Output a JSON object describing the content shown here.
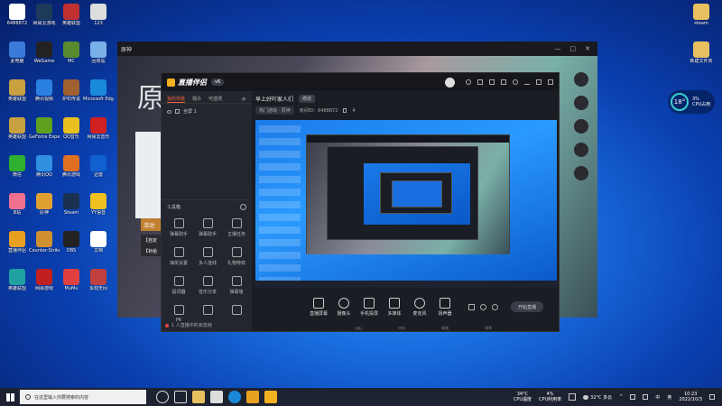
{
  "desktop": {
    "left_icons": [
      {
        "label": "6488872",
        "color": "#ffffff"
      },
      {
        "label": "网易云游戏",
        "color": "#1e3a5a"
      },
      {
        "label": "英雄联盟",
        "color": "#c03030"
      },
      {
        "label": "123",
        "color": "#dddddd"
      },
      {
        "label": "此电脑",
        "color": "#3a7ad8"
      },
      {
        "label": "WeGame",
        "color": "#222222"
      },
      {
        "label": "MC",
        "color": "#5a8a30"
      },
      {
        "label": "回收站",
        "color": "#7ab0e8"
      },
      {
        "label": "英雄联盟",
        "color": "#c8a040"
      },
      {
        "label": "腾讯视频",
        "color": "#2a80e0"
      },
      {
        "label": "炉石传说",
        "color": "#a06030"
      },
      {
        "label": "Microsoft Edge",
        "color": "#1a8ad8"
      },
      {
        "label": "英雄联盟",
        "color": "#c8a040"
      },
      {
        "label": "GeForce Experience",
        "color": "#60a020"
      },
      {
        "label": "QQ音乐",
        "color": "#e8c020"
      },
      {
        "label": "网易云音乐",
        "color": "#d02020"
      },
      {
        "label": "微信",
        "color": "#30b030"
      },
      {
        "label": "腾讯QQ",
        "color": "#3090e0"
      },
      {
        "label": "腾讯游戏",
        "color": "#e07020"
      },
      {
        "label": "迅雷",
        "color": "#1060d0"
      },
      {
        "label": "B站",
        "color": "#f07090"
      },
      {
        "label": "原神",
        "color": "#e0a030"
      },
      {
        "label": "Steam",
        "color": "#1a3050"
      },
      {
        "label": "YY语音",
        "color": "#f0c020"
      },
      {
        "label": "直播伴侣",
        "color": "#e8a020"
      },
      {
        "label": "Counter-Strike",
        "color": "#d09030"
      },
      {
        "label": "OBS",
        "color": "#222222"
      },
      {
        "label": "文档",
        "color": "#ffffff"
      },
      {
        "label": "英雄联盟",
        "color": "#20a0a0"
      },
      {
        "label": "网易游戏",
        "color": "#c02020"
      },
      {
        "label": "MuMu",
        "color": "#e04040"
      },
      {
        "label": "永劫无间",
        "color": "#c04040"
      }
    ],
    "right_icons": [
      {
        "label": "steam",
        "color": "#e8c060"
      },
      {
        "label": "新建文件夹",
        "color": "#e8c060"
      }
    ],
    "cpu_widget": {
      "temp": "18°",
      "percent": "3%",
      "label": "CPU占用"
    }
  },
  "game_window": {
    "title": "原神",
    "controls": [
      "—",
      "□",
      "✕"
    ],
    "side_texts": [
      "活动",
      "【自定",
      "【补给"
    ]
  },
  "streamer": {
    "logo": "直播伴侣",
    "version": "v6",
    "left_tabs": [
      "我的场景",
      "观众",
      "可选项"
    ],
    "scene_item": "全屏 1",
    "tools_title": "工具箱",
    "tools": [
      "弹幕助手",
      "弹幕助手",
      "主播任务",
      "抽奖设置",
      "多人连线",
      "礼物特效",
      "提词器",
      "音乐分享",
      "弹幕墙",
      "PK",
      "",
      ""
    ],
    "live_title": "早上好吖家人们",
    "live_badge": "修改",
    "category": "热门游戏 · 原神",
    "room_id": "房间ID：6488872",
    "fans": "4",
    "bottom_controls": [
      "直播屏幕",
      "摄像头",
      "手机投屏",
      "多媒体",
      "麦克风",
      "扬声器"
    ],
    "start_button": "开始直播",
    "status_text": "1 人直播中的状态帧",
    "status_bar": [
      "CPU",
      "内存",
      "网络",
      "帧率"
    ]
  },
  "taskbar": {
    "search_placeholder": "在这里输入你要搜索的内容",
    "cpu_temp": "34°C",
    "cpu_temp_label": "CPU温度",
    "cpu_pct": "4%",
    "cpu_pct_label": "CPU利用率",
    "weather": "32°C 多云",
    "ime": "中",
    "lang": "英",
    "time": "10:23",
    "date": "2022/10/3"
  }
}
